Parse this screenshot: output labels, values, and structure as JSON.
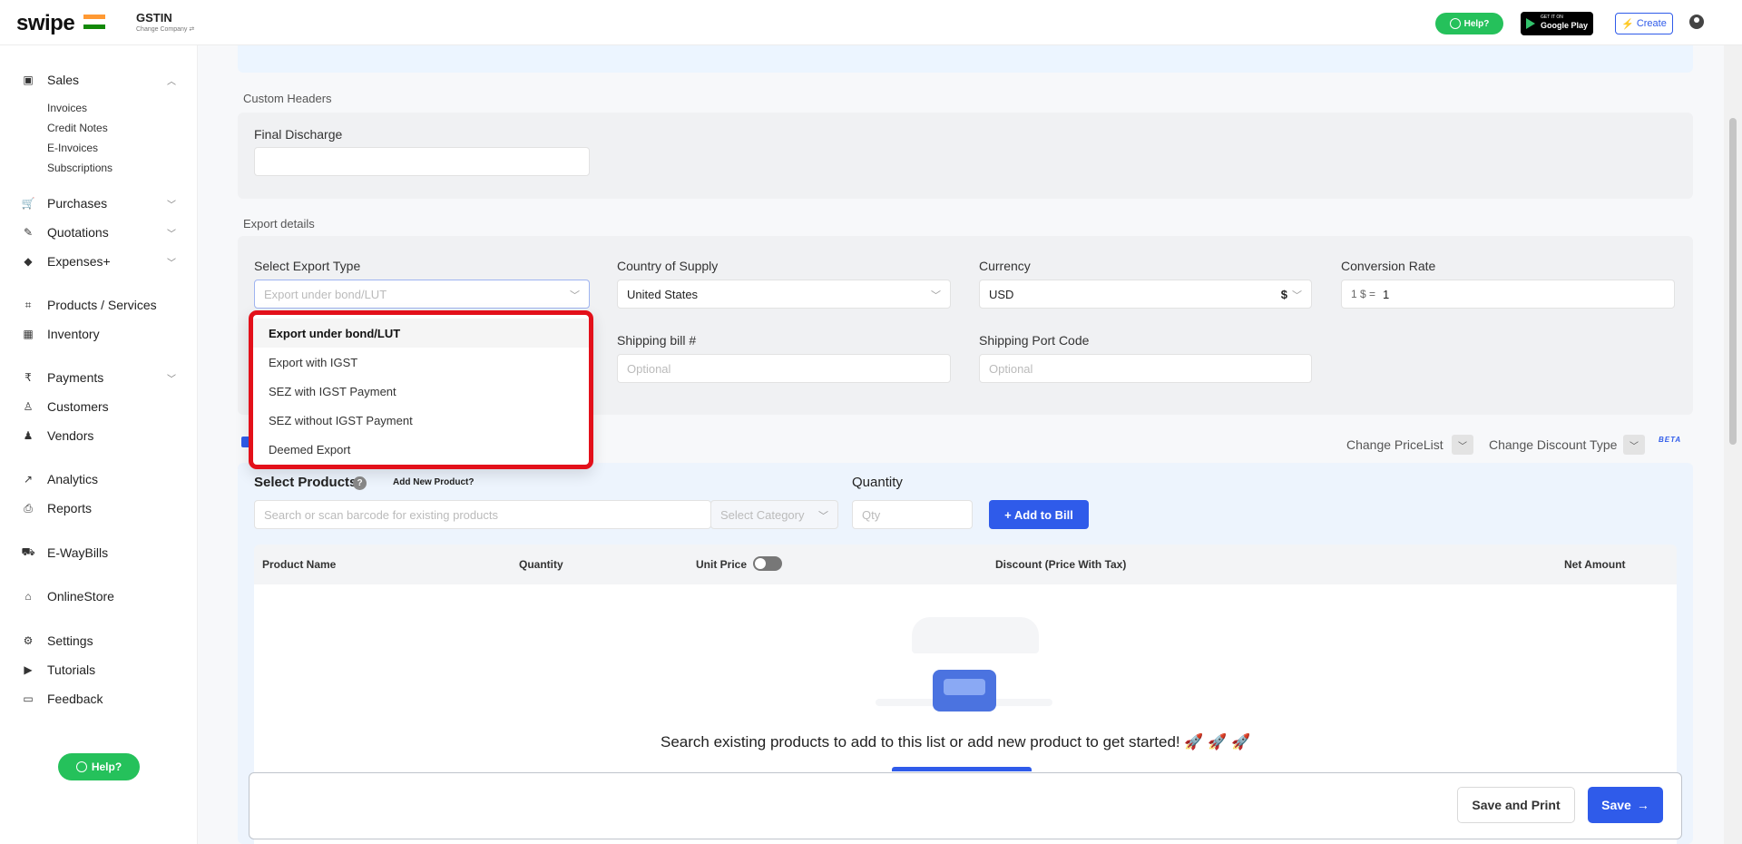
{
  "header": {
    "logo": "swipe",
    "company_name": "GSTIN",
    "company_sub": "Change Company ⇄",
    "help_label": "Help?",
    "gplay_small": "GET IT ON",
    "gplay_big": "Google Play",
    "create_label": "Create"
  },
  "sidebar": {
    "sales": "Sales",
    "sales_sub": [
      "Invoices",
      "Credit Notes",
      "E-Invoices",
      "Subscriptions"
    ],
    "purchases": "Purchases",
    "quotations": "Quotations",
    "expenses": "Expenses+",
    "products": "Products / Services",
    "inventory": "Inventory",
    "payments": "Payments",
    "customers": "Customers",
    "vendors": "Vendors",
    "analytics": "Analytics",
    "reports": "Reports",
    "ewaybills": "E-WayBills",
    "onlinestore": "OnlineStore",
    "settings": "Settings",
    "tutorials": "Tutorials",
    "feedback": "Feedback",
    "help_label": "Help?"
  },
  "custom_headers": {
    "title": "Custom Headers",
    "final_discharge_label": "Final Discharge"
  },
  "export_details": {
    "title": "Export details",
    "export_type_label": "Select Export Type",
    "export_type_value": "Export under bond/LUT",
    "country_label": "Country of Supply",
    "country_value": "United States",
    "currency_label": "Currency",
    "currency_value": "USD",
    "currency_symbol": "$",
    "conversion_label": "Conversion Rate",
    "conversion_prefix": "1 $ =",
    "conversion_value": "1",
    "shipping_bill_label": "Shipping bill #",
    "shipping_bill_placeholder": "Optional",
    "port_code_label": "Shipping Port Code",
    "port_code_placeholder": "Optional"
  },
  "export_type_options": [
    "Export under bond/LUT",
    "Export with IGST",
    "SEZ with IGST Payment",
    "SEZ without IGST Payment",
    "Deemed Export"
  ],
  "pricing": {
    "change_pricelist": "Change PriceList",
    "change_discount": "Change Discount Type",
    "beta": "BETA"
  },
  "products": {
    "select_label": "Select Products",
    "add_new": "Add New Product?",
    "search_placeholder": "Search or scan barcode for existing products",
    "category_placeholder": "Select Category",
    "quantity_label": "Quantity",
    "qty_placeholder": "Qty",
    "add_to_bill": "+ Add to Bill",
    "columns": [
      "Product Name",
      "Quantity",
      "Unit Price",
      "Discount (Price With Tax)",
      "Net Amount"
    ],
    "empty_message": "Search existing products to add to this list or add new product to get started! 🚀 🚀 🚀"
  },
  "actions": {
    "save_and_print": "Save and Print",
    "save": "Save"
  },
  "colors": {
    "primary": "#2f5bea",
    "whatsapp": "#25c15b",
    "highlight_border": "#e3101a"
  }
}
